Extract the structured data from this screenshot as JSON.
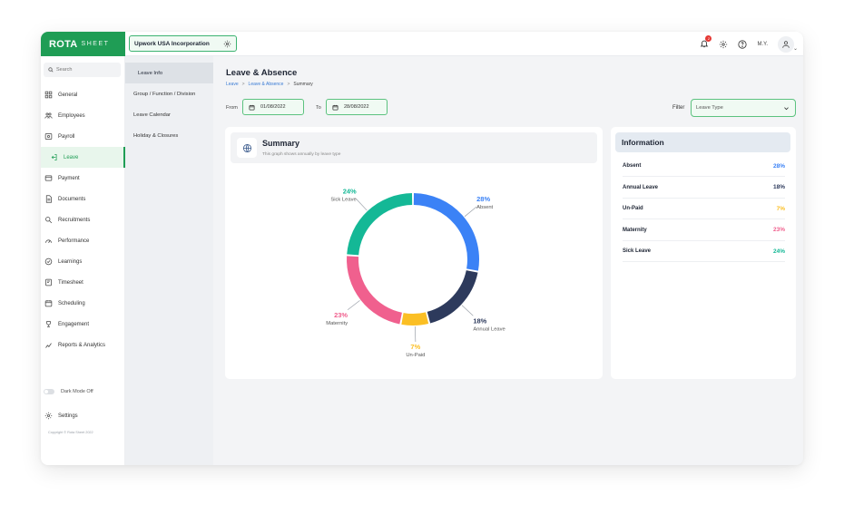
{
  "brand": {
    "name": "ROTA",
    "suffix": "SHEET"
  },
  "company": {
    "name": "Upwork USA Incorporation"
  },
  "topbar": {
    "initials": "M.Y.",
    "notification_count": "2"
  },
  "sidebar": {
    "search_placeholder": "Search",
    "items": [
      {
        "label": "General",
        "icon": "grid-icon"
      },
      {
        "label": "Employees",
        "icon": "users-icon"
      },
      {
        "label": "Payroll",
        "icon": "payroll-icon"
      },
      {
        "label": "Leave",
        "icon": "leave-icon"
      },
      {
        "label": "Payment",
        "icon": "payment-icon"
      },
      {
        "label": "Documents",
        "icon": "document-icon"
      },
      {
        "label": "Recruitments",
        "icon": "search-person-icon"
      },
      {
        "label": "Performance",
        "icon": "gauge-icon"
      },
      {
        "label": "Learnings",
        "icon": "learning-icon"
      },
      {
        "label": "Timesheet",
        "icon": "timesheet-icon"
      },
      {
        "label": "Scheduling",
        "icon": "calendar-icon"
      },
      {
        "label": "Engagement",
        "icon": "trophy-icon"
      },
      {
        "label": "Reports & Analytics",
        "icon": "analytics-icon"
      }
    ],
    "dark_mode": "Dark Mode Off",
    "settings": "Settings",
    "copyright": "Copyright © Rota Sheet 2022"
  },
  "subnav": [
    "Leave Info",
    "Group / Function / Division",
    "Leave Calendar",
    "Holiday & Closures"
  ],
  "page": {
    "title": "Leave & Absence",
    "breadcrumb": [
      "Leave",
      "Leave & Absence",
      "Summary"
    ],
    "from_label": "From",
    "from_date": "01/08/2022",
    "to_label": "To",
    "to_date": "28/08/2022",
    "filter_label": "Filter",
    "filter_value": "Leave Type"
  },
  "summary": {
    "title": "Summary",
    "subtitle": "This graph shows annually by leave type"
  },
  "chart_data": {
    "type": "pie",
    "categories": [
      "Absent",
      "Annual Leave",
      "Un-Paid",
      "Maternity",
      "Sick Leave"
    ],
    "values": [
      28,
      18,
      7,
      23,
      24
    ],
    "labels": [
      "28%",
      "18%",
      "7%",
      "23%",
      "24%"
    ],
    "colors": [
      "#3b82f6",
      "#2d3a5c",
      "#fbbf24",
      "#f0608e",
      "#14b896"
    ],
    "style": "donut"
  },
  "info": {
    "title": "Information",
    "rows": [
      {
        "label": "Absent",
        "value": "28%",
        "color": "#3b82f6"
      },
      {
        "label": "Annual Leave",
        "value": "18%",
        "color": "#2d3a5c"
      },
      {
        "label": "Un-Paid",
        "value": "7%",
        "color": "#fbbf24"
      },
      {
        "label": "Maternity",
        "value": "23%",
        "color": "#f0608e"
      },
      {
        "label": "Sick Leave",
        "value": "24%",
        "color": "#14b896"
      }
    ]
  }
}
